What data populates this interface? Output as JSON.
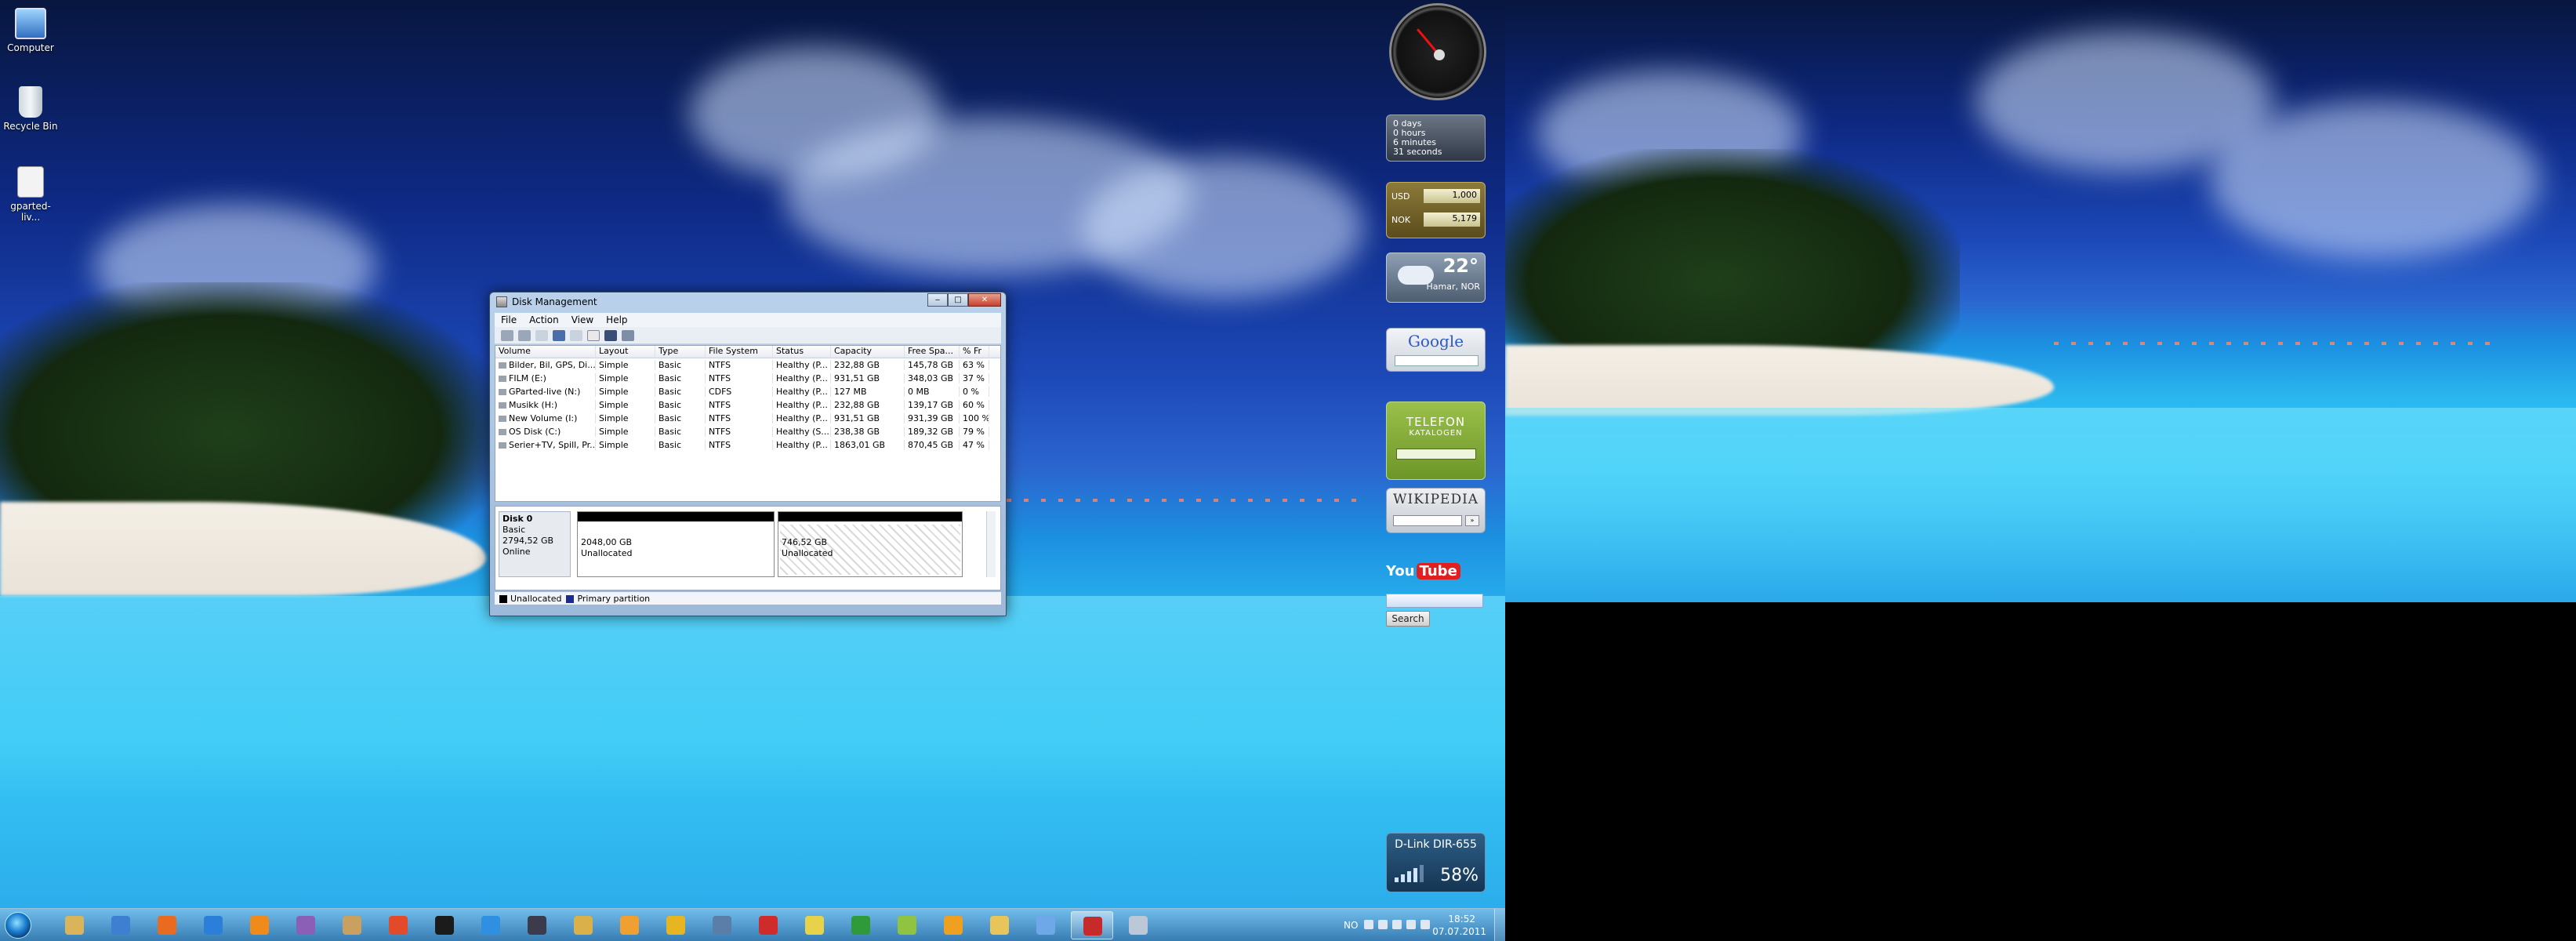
{
  "desktop": {
    "icons": [
      {
        "label": "Computer",
        "icon": "computer-icon"
      },
      {
        "label": "Recycle Bin",
        "icon": "recycle-bin-icon"
      },
      {
        "label": "gparted-liv...",
        "icon": "file-icon"
      }
    ]
  },
  "gadgets": {
    "uptime": {
      "days": "0 days",
      "hours": "0 hours",
      "minutes": "6 minutes",
      "seconds": "31 seconds"
    },
    "currency": {
      "rows": [
        {
          "code": "USD",
          "value": "1,000"
        },
        {
          "code": "NOK",
          "value": "5,179"
        }
      ]
    },
    "weather": {
      "temp": "22°",
      "place": "Hamar, NOR"
    },
    "google": {
      "logo": "Google"
    },
    "telefon": {
      "line1": "TELEFON",
      "line2": "KATALOGEN"
    },
    "wikipedia": {
      "logo": "WIKIPEDIA",
      "go": "»"
    },
    "youtube": {
      "you": "You",
      "tube": "Tube",
      "search_label": "Search"
    },
    "wifi": {
      "name": "D-Link DIR-655",
      "signal": "58%"
    }
  },
  "disk_management": {
    "title": "Disk Management",
    "menu": [
      "File",
      "Action",
      "View",
      "Help"
    ],
    "columns": [
      "Volume",
      "Layout",
      "Type",
      "File System",
      "Status",
      "Capacity",
      "Free Spa...",
      "% Fr"
    ],
    "rows": [
      [
        "Bilder, Bil, GPS, Di...",
        "Simple",
        "Basic",
        "NTFS",
        "Healthy (P...",
        "232,88 GB",
        "145,78 GB",
        "63 %"
      ],
      [
        "FILM (E:)",
        "Simple",
        "Basic",
        "NTFS",
        "Healthy (P...",
        "931,51 GB",
        "348,03 GB",
        "37 %"
      ],
      [
        "GParted-live (N:)",
        "Simple",
        "Basic",
        "CDFS",
        "Healthy (P...",
        "127 MB",
        "0 MB",
        "0 %"
      ],
      [
        "Musikk (H:)",
        "Simple",
        "Basic",
        "NTFS",
        "Healthy (P...",
        "232,88 GB",
        "139,17 GB",
        "60 %"
      ],
      [
        "New Volume (I:)",
        "Simple",
        "Basic",
        "NTFS",
        "Healthy (P...",
        "931,51 GB",
        "931,39 GB",
        "100 %"
      ],
      [
        "OS Disk (C:)",
        "Simple",
        "Basic",
        "NTFS",
        "Healthy (S...",
        "238,38 GB",
        "189,32 GB",
        "79 %"
      ],
      [
        "Serier+TV, Spill, Pr...",
        "Simple",
        "Basic",
        "NTFS",
        "Healthy (P...",
        "1863,01 GB",
        "870,45 GB",
        "47 %"
      ]
    ],
    "disk": {
      "name": "Disk 0",
      "type": "Basic",
      "size": "2794,52 GB",
      "state": "Online"
    },
    "partitions": [
      {
        "size": "2048,00 GB",
        "status": "Unallocated"
      },
      {
        "size": "746,52 GB",
        "status": "Unallocated"
      }
    ],
    "legend": [
      {
        "label": "Unallocated",
        "color": "#000000"
      },
      {
        "label": "Primary partition",
        "color": "#1c2a8c"
      }
    ]
  },
  "taskbar": {
    "apps": [
      "explorer",
      "control-panel",
      "firefox",
      "internet-explorer",
      "vlc",
      "winrar",
      "book",
      "app-red",
      "steam",
      "app-blue",
      "game",
      "tool",
      "media-player",
      "app-person",
      "calculator",
      "ccleaner",
      "app-yellow",
      "utorrent",
      "android",
      "app-orange",
      "folder",
      "network",
      "disk-management",
      "remote"
    ],
    "tray": {
      "language": "NO",
      "time": "18:52",
      "date": "07.07.2011"
    }
  }
}
